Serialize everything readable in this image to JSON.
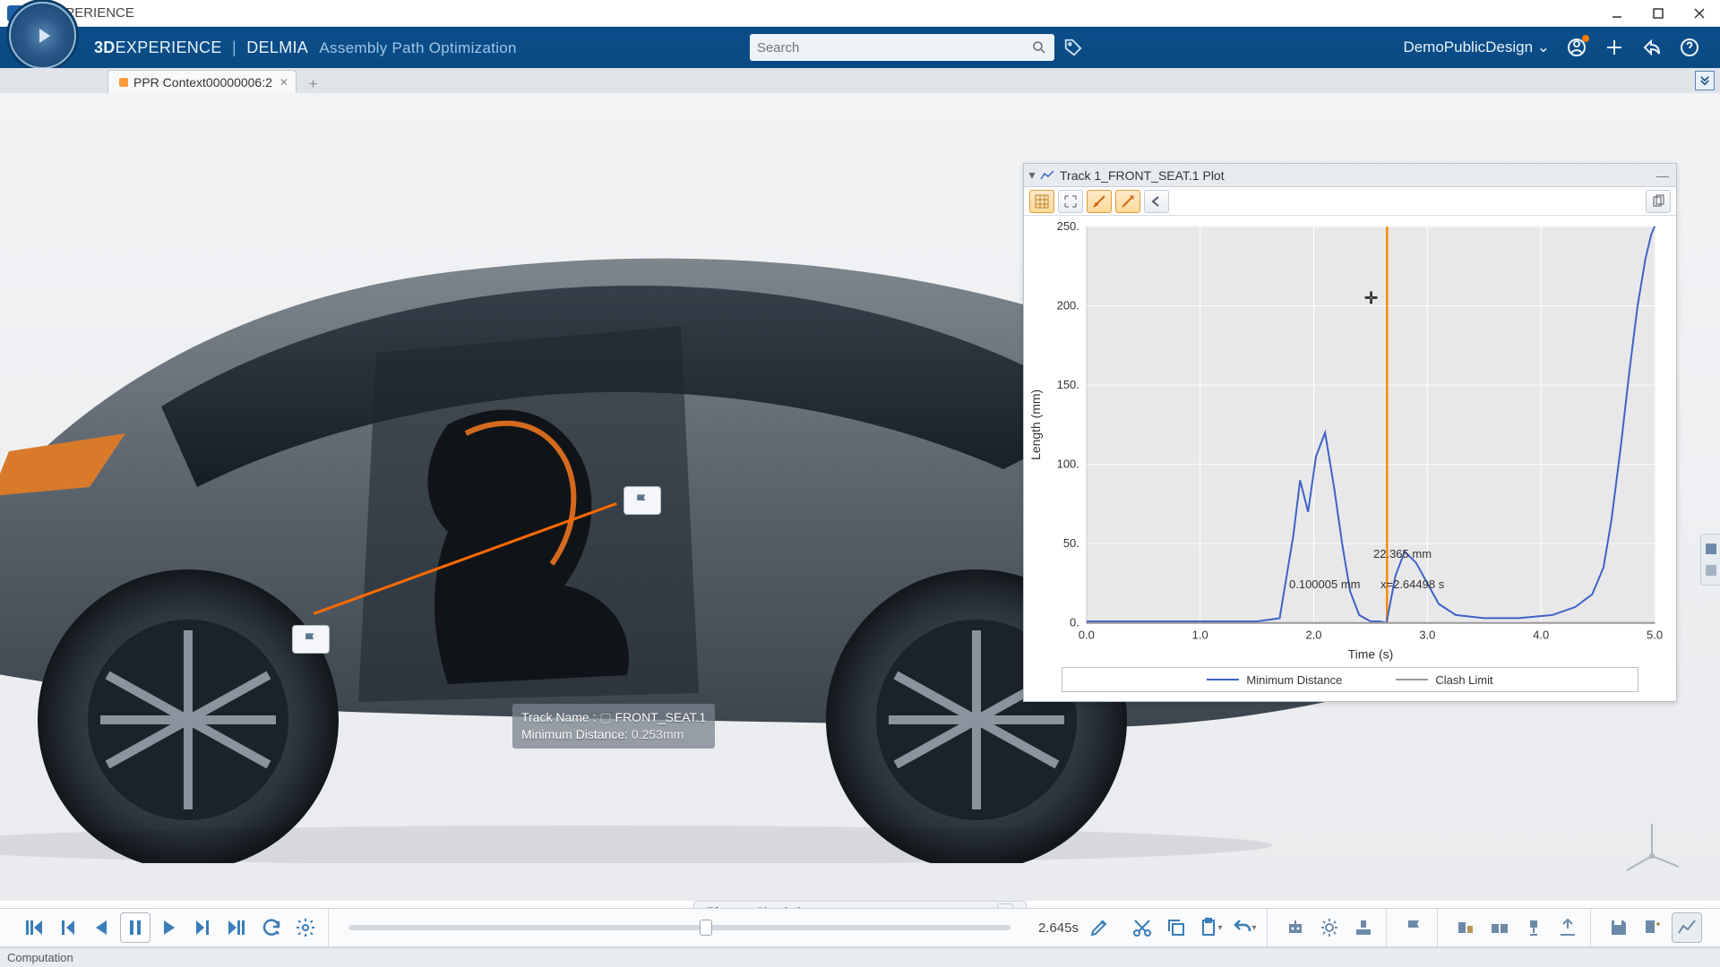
{
  "window": {
    "title": "3DEXPERIENCE"
  },
  "header": {
    "brand_prefix": "3D",
    "brand_main": "EXPERIENCE",
    "brand_pipe": "|",
    "brand_app": "DELMIA",
    "brand_sub": "Assembly Path Optimization",
    "search_placeholder": "Search",
    "user": "DemoPublicDesign"
  },
  "tab": {
    "label": "PPR Context00000006:2"
  },
  "viewport": {
    "tooltip_line1": "Track Name :",
    "tooltip_line1_val": "FRONT_SEAT.1",
    "tooltip_line2": "Minimum Distance:",
    "tooltip_line2_val": "0.253mm"
  },
  "plot": {
    "title": "Track 1_FRONT_SEAT.1 Plot",
    "xlabel": "Time (s)",
    "ylabel": "Length (mm)",
    "legend": {
      "series1": "Minimum Distance",
      "series2": "Clash Limit"
    },
    "annot1": "22.365 mm",
    "annot2a": "0.100005 mm",
    "annot2b": "x=2.64498 s"
  },
  "chart_data": {
    "type": "line",
    "xlabel": "Time (s)",
    "ylabel": "Length (mm)",
    "xlim": [
      0.0,
      5.0
    ],
    "ylim": [
      0,
      250
    ],
    "xticks": [
      0.0,
      1.0,
      2.0,
      3.0,
      4.0,
      5.0
    ],
    "yticks": [
      0,
      50,
      100,
      150,
      200,
      250
    ],
    "series": [
      {
        "name": "Minimum Distance",
        "color": "#3d63c7",
        "x": [
          0.0,
          0.3,
          0.6,
          0.9,
          1.2,
          1.5,
          1.7,
          1.82,
          1.88,
          1.95,
          2.02,
          2.1,
          2.18,
          2.25,
          2.32,
          2.4,
          2.5,
          2.58,
          2.64,
          2.72,
          2.8,
          2.9,
          3.0,
          3.1,
          3.25,
          3.5,
          3.8,
          4.1,
          4.3,
          4.45,
          4.55,
          4.62,
          4.7,
          4.78,
          4.85,
          4.92,
          4.97,
          5.0
        ],
        "y": [
          1,
          1,
          1,
          1,
          1,
          1,
          3,
          55,
          90,
          70,
          105,
          120,
          85,
          50,
          20,
          5,
          1,
          1,
          0.1,
          30,
          45,
          38,
          25,
          12,
          5,
          3,
          3,
          5,
          10,
          18,
          35,
          65,
          110,
          160,
          200,
          230,
          245,
          250
        ]
      },
      {
        "name": "Clash Limit",
        "color": "#9a9a9a",
        "x": [
          0.0,
          5.0
        ],
        "y": [
          0.0,
          0.0
        ]
      }
    ],
    "cursor_x": 2.64498,
    "cursor_color": "#ff8a00",
    "annotations": [
      {
        "text": "22.365 mm",
        "x": 2.75,
        "y": 25
      },
      {
        "text": "0.100005 mm",
        "x": 2.1,
        "y": 2
      },
      {
        "text": "x=2.64498 s",
        "x": 2.7,
        "y": 2
      }
    ]
  },
  "player": {
    "mode1": "Play",
    "mode2": "Simulation",
    "time": "2.645s",
    "progress": 0.53
  },
  "status": "Computation"
}
